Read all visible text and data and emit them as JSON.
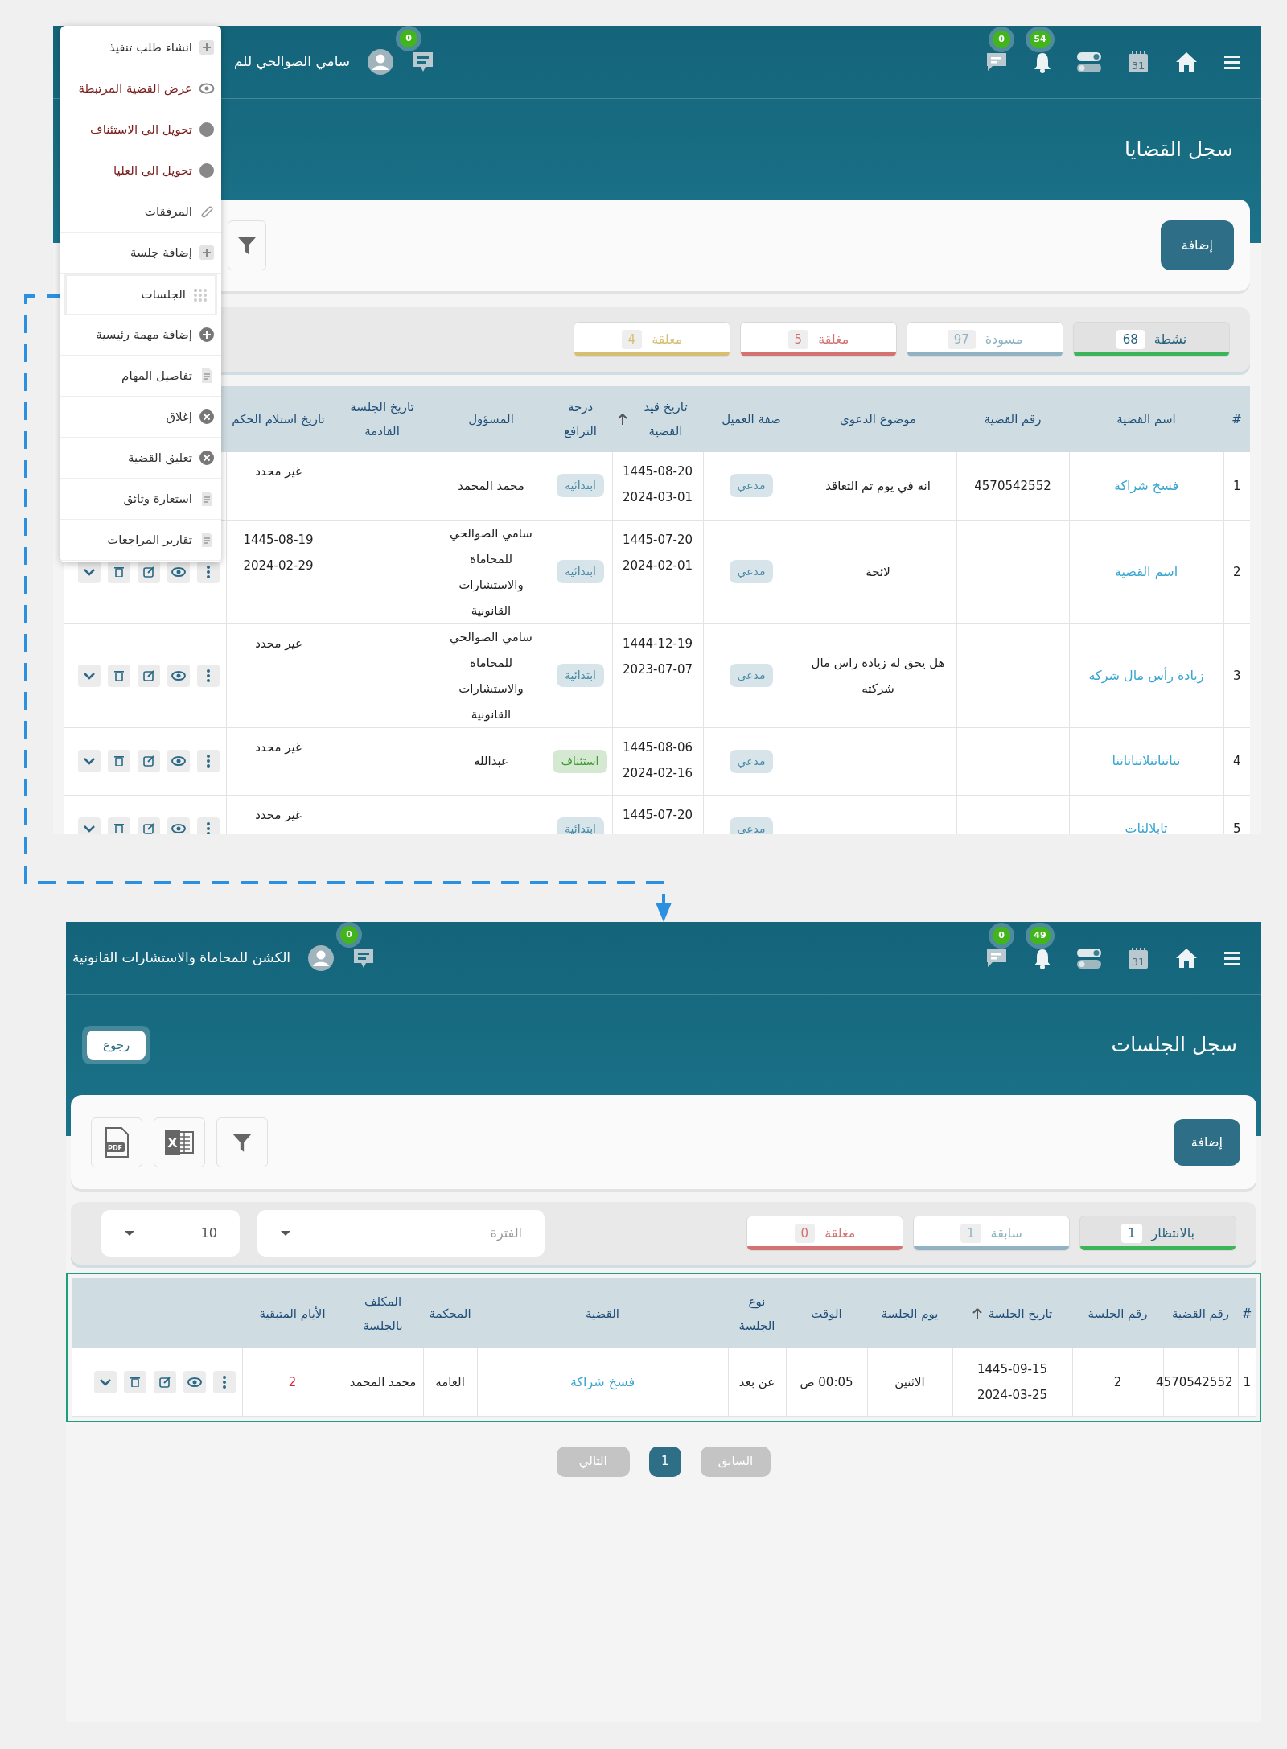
{
  "case_register": {
    "top_bar": {
      "calendar_day": "31",
      "notifications_badge": "54",
      "messages_badge": "0",
      "chat_badge": "0",
      "user_name": "سامي الصوالحي للم"
    },
    "title": "سجل القضايا",
    "add_button": "إضافة",
    "status_tabs": [
      {
        "label": "نشطة",
        "count": "68",
        "color": "#3cb55a",
        "selected": true
      },
      {
        "label": "مسودة",
        "count": "97",
        "color": "#8fb3c4",
        "selected": false
      },
      {
        "label": "مغلقة",
        "count": "5",
        "color": "#d47272",
        "selected": false
      },
      {
        "label": "معلقة",
        "count": "4",
        "color": "#d8be72",
        "selected": false
      }
    ],
    "columns": [
      {
        "label": "#",
        "sorted": false
      },
      {
        "label": "اسم القضية",
        "sorted": false
      },
      {
        "label": "رقم القضية",
        "sorted": false
      },
      {
        "label": "موضوع الدعوى",
        "sorted": false
      },
      {
        "label": "صفة العميل",
        "sorted": false
      },
      {
        "label": "تاريخ قيد القضية",
        "sorted": true
      },
      {
        "label": "درجة الترافع",
        "sorted": false
      },
      {
        "label": "المسؤول",
        "sorted": false
      },
      {
        "label": "تاريخ الجلسة القادمة",
        "sorted": false
      },
      {
        "label": "تاريخ استلام الحكم",
        "sorted": false
      }
    ],
    "rows": [
      {
        "number": "1",
        "case_name": "فسخ شراكة",
        "case_number": "4570542552",
        "subject": "انه في يوم تم التعاقد",
        "client_role": "مدعي",
        "filing_date": "1445-08-20\n2024-03-01",
        "degree": {
          "label": "ابتدائية",
          "color": "#4a8aa3"
        },
        "responsible": "محمد المحمد",
        "judgment_date": "غير محدد"
      },
      {
        "number": "2",
        "case_name": "اسم القضية",
        "subject": "لائحة",
        "client_role": "مدعي",
        "filing_date": "1445-07-20\n2024-02-01",
        "degree": {
          "label": "ابتدائية",
          "color": "#4a8aa3"
        },
        "responsible": "سامي الصوالحي للمحاماة والاستشارات القانونية",
        "judgment_date": "1445-08-19\n2024-02-29"
      },
      {
        "number": "3",
        "case_name": "زيادة رأس مال شركه",
        "subject": "هل يحق له زيادة راس مال شركته",
        "client_role": "مدعي",
        "filing_date": "1444-12-19\n2023-07-07",
        "degree": {
          "label": "ابتدائية",
          "color": "#4a8aa3"
        },
        "responsible": "سامي الصوالحي للمحاماة والاستشارات القانونية",
        "judgment_date": "غير محدد"
      },
      {
        "number": "4",
        "case_name": "تناتناتنلاتناتاتنا",
        "client_role": "مدعي",
        "filing_date": "1445-08-06\n2024-02-16",
        "degree": {
          "label": "استئناف",
          "color": "#3f9a34"
        },
        "responsible": "عبدالله",
        "judgment_date": "غير محدد"
      },
      {
        "number": "5",
        "case_name": "تابلالنات",
        "client_role": "مدعي",
        "filing_date": "1445-07-20",
        "degree": {
          "label": "ابتدائية",
          "color": "#4a8aa3"
        },
        "judgment_date": "غير محدد"
      }
    ],
    "actions_menu": [
      {
        "label": "انشاء طلب تنفيذ",
        "kind": "plus-square",
        "color": "#333333",
        "selected": false
      },
      {
        "label": "عرض القضية المرتبطة",
        "kind": "eye",
        "color": "#7a1d1d",
        "selected": false
      },
      {
        "label": "تحويل الى الاستئناف",
        "kind": "dot",
        "color": "#7a1d1d",
        "selected": false
      },
      {
        "label": "تحويل الى العليا",
        "kind": "dot",
        "color": "#7a1d1d",
        "selected": false
      },
      {
        "label": "المرفقات",
        "kind": "clip",
        "color": "#333333",
        "selected": false
      },
      {
        "label": "إضافة جلسة",
        "kind": "plus-square",
        "color": "#333333",
        "selected": false
      },
      {
        "label": "الجلسات",
        "kind": "grid",
        "color": "#333333",
        "selected": true
      },
      {
        "label": "إضافة مهمة رئيسية",
        "kind": "plus-circle",
        "color": "#333333",
        "selected": false
      },
      {
        "label": "تفاصيل المهام",
        "kind": "doc",
        "color": "#333333",
        "selected": false
      },
      {
        "label": "إغلاق",
        "kind": "x-circle",
        "color": "#333333",
        "selected": false
      },
      {
        "label": "تعليق القضية",
        "kind": "x-circle",
        "color": "#333333",
        "selected": false
      },
      {
        "label": "استعارة وثائق",
        "kind": "doc",
        "color": "#333333",
        "selected": false
      },
      {
        "label": "تقارير المراجعات",
        "kind": "doc",
        "color": "#333333",
        "selected": false
      }
    ]
  },
  "sessions_register": {
    "top_bar": {
      "calendar_day": "31",
      "notifications_badge": "49",
      "messages_badge": "0",
      "chat_badge": "0",
      "user_name": "الكشن للمحاماة والاستشارات القانونية"
    },
    "title": "سجل الجلسات",
    "back_button": "رجوع",
    "add_button": "إضافة",
    "file_icon_labels": {
      "excel": "X",
      "pdf": "PDF"
    },
    "status_tabs": [
      {
        "label": "بالانتظار",
        "count": "1",
        "color": "#3cb55a",
        "selected": true
      },
      {
        "label": "سابقة",
        "count": "1",
        "color": "#8fb3c4",
        "selected": false
      },
      {
        "label": "مغلقة",
        "count": "0",
        "color": "#d47272",
        "selected": false
      }
    ],
    "period_select": {
      "placeholder": "الفترة"
    },
    "page_size_select": {
      "value": "10"
    },
    "columns": [
      {
        "label": "#",
        "sorted": false
      },
      {
        "label": "رقم القضية",
        "sorted": false
      },
      {
        "label": "رقم الجلسة",
        "sorted": false
      },
      {
        "label": "تاريخ الجلسة",
        "sorted": true
      },
      {
        "label": "يوم الجلسة",
        "sorted": false
      },
      {
        "label": "الوقت",
        "sorted": false
      },
      {
        "label": "نوع الجلسة",
        "sorted": false
      },
      {
        "label": "القضية",
        "sorted": false
      },
      {
        "label": "المحكمة",
        "sorted": false
      },
      {
        "label": "المكلف بالجلسة",
        "sorted": false
      },
      {
        "label": "الأيام المتبقية",
        "sorted": false
      }
    ],
    "rows": [
      {
        "number": "1",
        "case_number": "4570542552",
        "session_number": "2",
        "session_date": "1445-09-15\n2024-03-25",
        "day": "الاثنين",
        "time": "00:05 ص",
        "session_type": "عن بعد",
        "case": "فسخ شراكة",
        "court": "العامه",
        "assignee": "محمد المحمد",
        "days_left": "2"
      }
    ],
    "pagination": [
      {
        "label": "السابق",
        "kind": "previous",
        "selected": false
      },
      {
        "label": "1",
        "kind": "page",
        "selected": true
      },
      {
        "label": "التالي",
        "kind": "next",
        "selected": false
      }
    ]
  }
}
